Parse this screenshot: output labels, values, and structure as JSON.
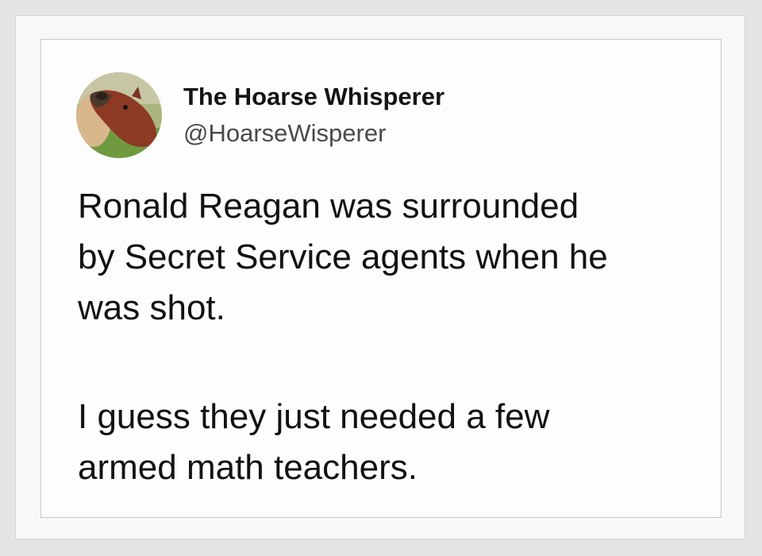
{
  "tweet": {
    "author": {
      "display_name": "The Hoarse Whisperer",
      "handle": "@HoarseWisperer",
      "avatar_icon": "horse-head-avatar"
    },
    "paragraphs": [
      {
        "lines": [
          "Ronald Reagan was surrounded",
          "by Secret Service agents when he",
          "was shot."
        ]
      },
      {
        "lines": [
          "I guess they just needed a few",
          "armed math teachers."
        ]
      }
    ]
  },
  "colors": {
    "background": "#e3e5e4",
    "card": "#fdfdfd",
    "text": "#121212",
    "handle_text": "#4a4a4a"
  }
}
